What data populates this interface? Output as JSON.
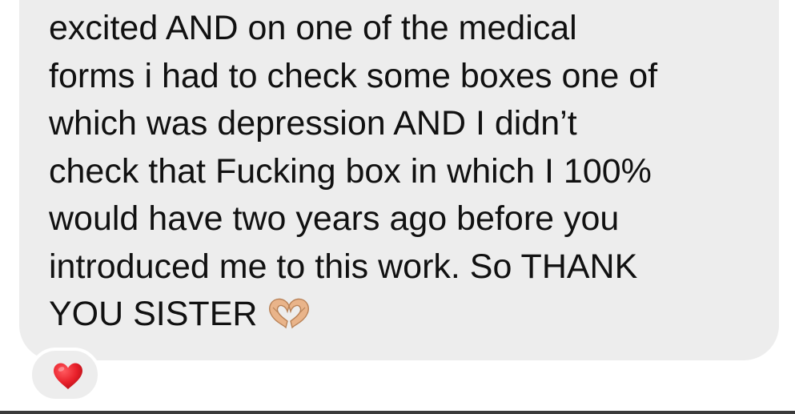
{
  "message": {
    "lines": [
      "excited AND on one of the medical",
      "forms i had to check some boxes one of",
      "which was depression AND I didn’t",
      "check that Fucking box in which I 100%",
      "would have two years ago before you",
      "introduced me to this work. So THANK",
      "YOU SISTER"
    ],
    "trailing_emoji": "heart-hands-icon"
  },
  "reaction": {
    "emoji": "red-heart-icon"
  },
  "colors": {
    "bubble": "#ededed",
    "text": "#111111",
    "heart": "#e8202a",
    "hands": "#e9b48a"
  }
}
